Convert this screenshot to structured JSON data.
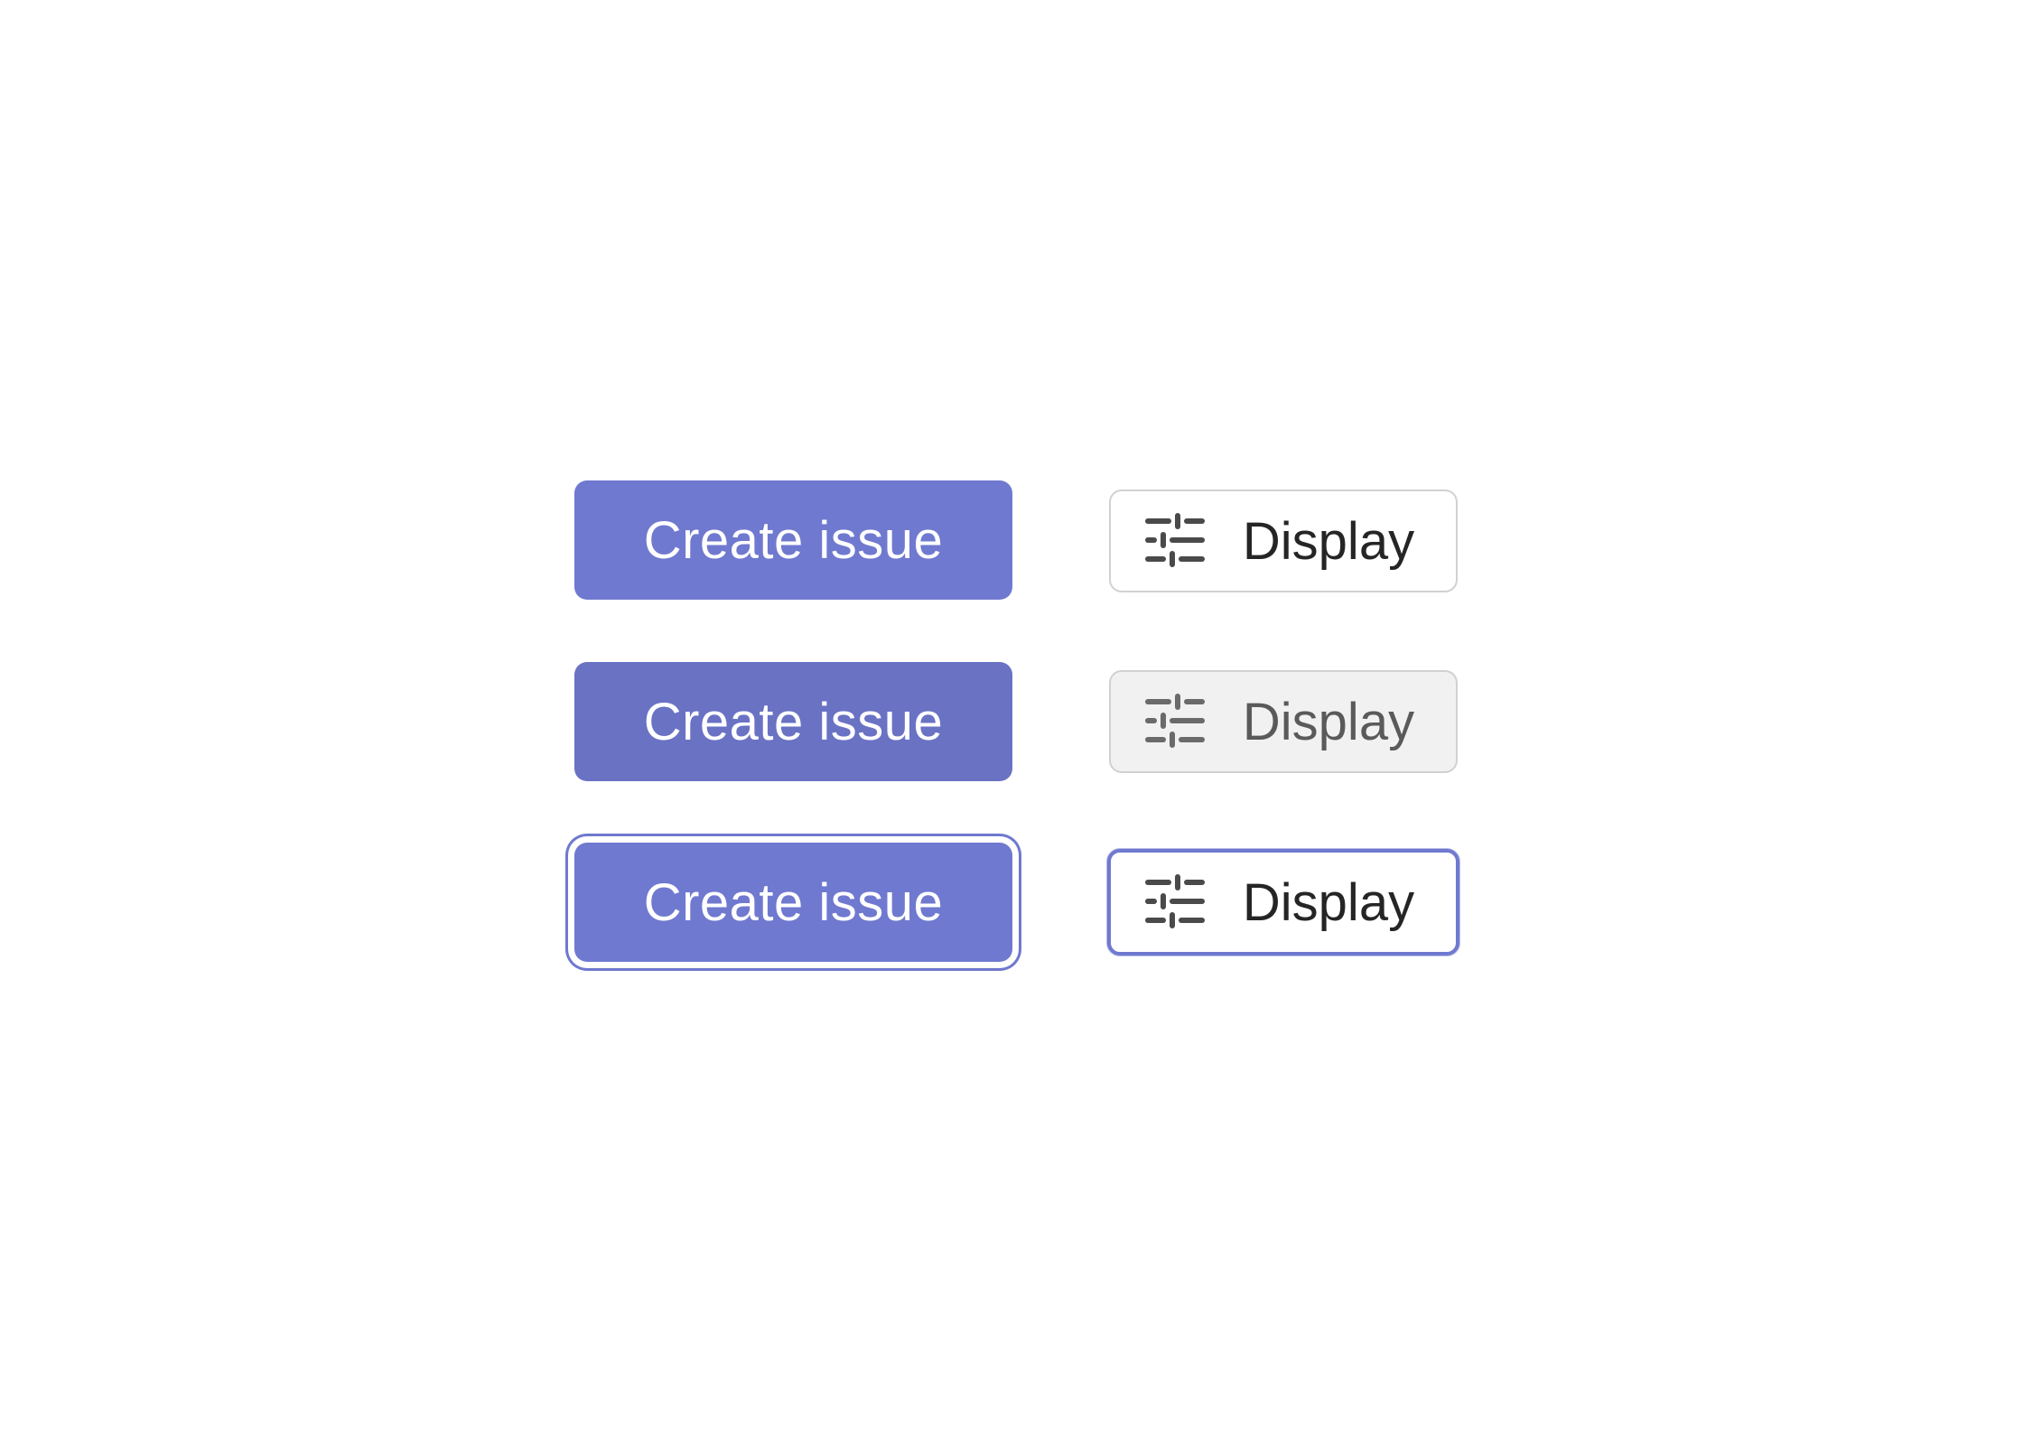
{
  "buttons": {
    "primary_label": "Create issue",
    "secondary_label": "Display",
    "secondary_icon": "sliders-icon"
  },
  "colors": {
    "primary": "#6f79cf",
    "primary_hover": "#6a72c4",
    "border": "#d1d1d1",
    "hover_background": "#f1f1f1",
    "text_dark": "#252525"
  },
  "states": [
    "default",
    "hover",
    "focus"
  ]
}
